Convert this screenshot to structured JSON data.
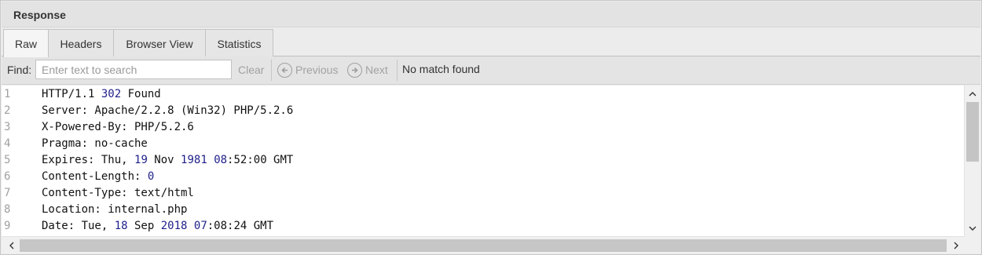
{
  "panel": {
    "title": "Response"
  },
  "tabs": [
    {
      "label": "Raw",
      "active": true
    },
    {
      "label": "Headers",
      "active": false
    },
    {
      "label": "Browser View",
      "active": false
    },
    {
      "label": "Statistics",
      "active": false
    }
  ],
  "search": {
    "find_label": "Find:",
    "placeholder": "Enter text to search",
    "value": "",
    "clear_label": "Clear",
    "previous_label": "Previous",
    "next_label": "Next",
    "status": "No match found"
  },
  "response_lines": [
    {
      "num": "1",
      "text": "HTTP/1.1 302 Found"
    },
    {
      "num": "2",
      "text": "Server: Apache/2.2.8 (Win32) PHP/5.2.6"
    },
    {
      "num": "3",
      "text": "X-Powered-By: PHP/5.2.6"
    },
    {
      "num": "4",
      "text": "Pragma: no-cache"
    },
    {
      "num": "5",
      "text": "Expires: Thu, 19 Nov 1981 08:52:00 GMT"
    },
    {
      "num": "6",
      "text": "Content-Length: 0"
    },
    {
      "num": "7",
      "text": "Content-Type: text/html"
    },
    {
      "num": "8",
      "text": "Location: internal.php"
    },
    {
      "num": "9",
      "text": "Date: Tue, 18 Sep 2018 07:08:24 GMT"
    }
  ],
  "colors": {
    "number_highlight": "#1f1f8a",
    "line_number": "#a0a0a0",
    "disabled_text": "#a2a2a2"
  },
  "icons": {
    "previous": "circle-arrow-left-icon",
    "next": "circle-arrow-right-icon",
    "scroll_up": "chevron-up-icon",
    "scroll_down": "chevron-down-icon",
    "scroll_left": "chevron-left-icon",
    "scroll_right": "chevron-right-icon"
  }
}
